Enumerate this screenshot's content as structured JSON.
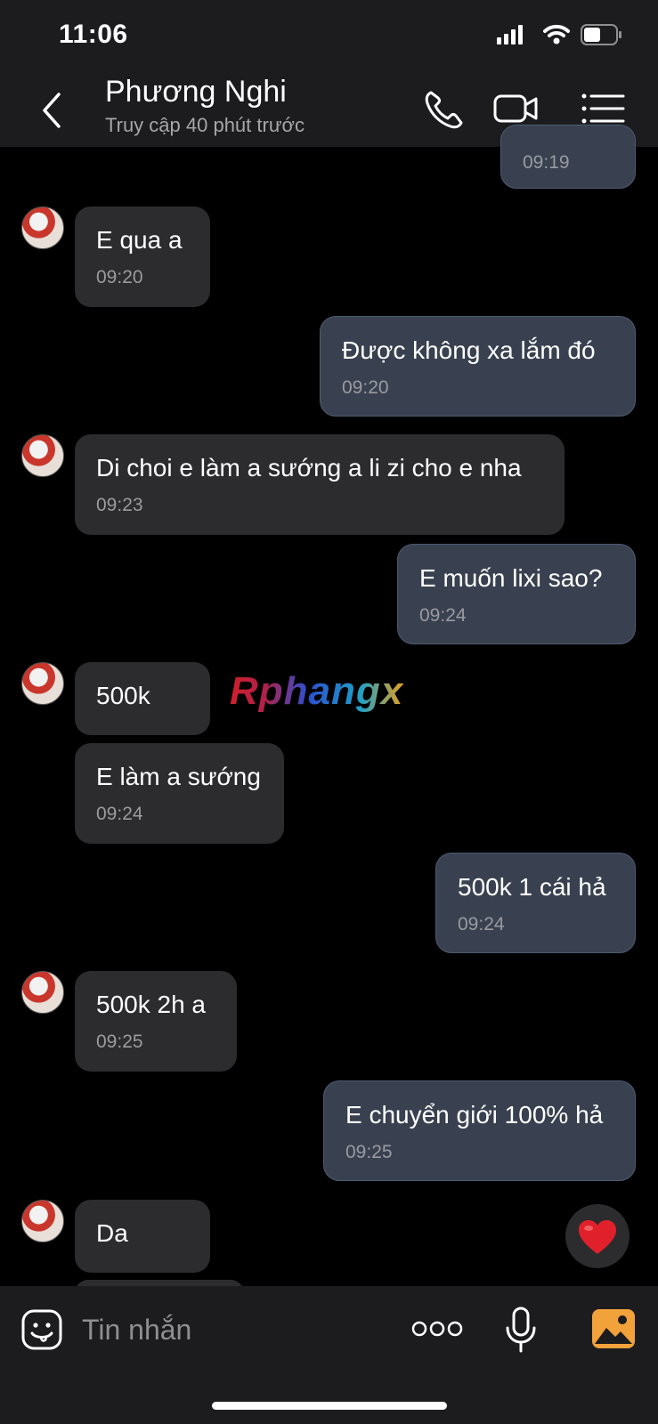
{
  "status": {
    "time": "11:06"
  },
  "header": {
    "name": "Phương Nghi",
    "status": "Truy cập 40 phút trước"
  },
  "messages": [
    {
      "side": "out",
      "text": "",
      "time": "09:19"
    },
    {
      "side": "in",
      "text": "E qua a",
      "time": "09:20"
    },
    {
      "side": "out",
      "text": "Được không xa lắm đó",
      "time": "09:20"
    },
    {
      "side": "in",
      "text": "Di choi e làm a sướng a li zi cho e nha",
      "time": "09:23"
    },
    {
      "side": "out",
      "text": "E muốn lixi sao?",
      "time": "09:24"
    },
    {
      "side": "in",
      "text": "500k",
      "time": ""
    },
    {
      "side": "in",
      "text": "E làm a sướng",
      "time": "09:24"
    },
    {
      "side": "out",
      "text": "500k 1 cái hả",
      "time": "09:24"
    },
    {
      "side": "in",
      "text": "500k 2h a",
      "time": "09:25"
    },
    {
      "side": "out",
      "text": "E chuyển giới 100% hả",
      "time": "09:25"
    },
    {
      "side": "in",
      "text": "Da",
      "time": ""
    }
  ],
  "watermark": "Rphangx",
  "composer": {
    "placeholder": "Tin nhắn"
  },
  "colors": {
    "incoming": "#2c2c2e",
    "outgoing": "#394150",
    "background": "#000000",
    "heart": "#e0212b",
    "gallery": "#f2a23a"
  }
}
